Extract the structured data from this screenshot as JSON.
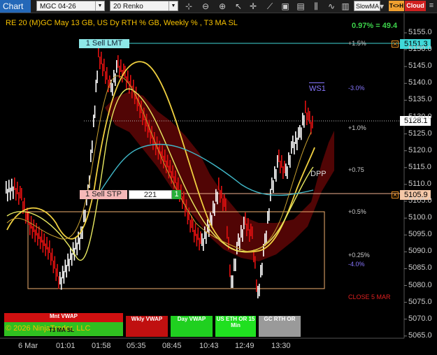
{
  "toolbar": {
    "tab": "Chart",
    "instrument": "MGC 04-26",
    "interval": "20 Renko",
    "strategy": "SlowMA",
    "tchk": "T<>H",
    "cloud": "Cloud"
  },
  "chart": {
    "title": "RE 20  (M)GC May 13 GB, US Dy RTH % GB, Weekly % , T3 MA SL",
    "ratio": "0.97% = 49.4",
    "price_axis": [
      "5155.0",
      "5150.0",
      "5145.0",
      "5140.0",
      "5135.0",
      "5130.0",
      "5125.0",
      "5120.0",
      "5115.0",
      "5110.0",
      "5105.0",
      "5100.0",
      "5095.0",
      "5090.0",
      "5085.0",
      "5080.0",
      "5075.0",
      "5070.0",
      "5065.0"
    ],
    "time_axis": [
      "6 Mar",
      "01:01",
      "01:58",
      "05:35",
      "08:45",
      "10:43",
      "12:49",
      "13:30"
    ],
    "current_price": "5128.1",
    "level_labels": {
      "p15": "+1.5%",
      "m30": "-3.0%",
      "p10": "+1.0%",
      "p075": "+0.75",
      "p05": "+0.5%",
      "p025": "+0.25%",
      "m40": "-4.0%"
    },
    "ws1": "WS1",
    "dpp": "DPP",
    "close_label": "CLOSE 5 MAR"
  },
  "orders": {
    "limit": {
      "label": "1 Sell LMT",
      "price": "5151.3"
    },
    "stop": {
      "label": "1 Sell STP",
      "qty": "221",
      "qty_tag": "1",
      "price": "5105.9"
    }
  },
  "legend": {
    "mnt": "Mnt VWAP",
    "t3": "T3 MA SL",
    "wkly": "Wkly VWAP",
    "day": "Day VWAP",
    "useth": "US ETH OR 15 Min",
    "gcrth": "GC RTH OR",
    "copyright": "© 2026 NinjaTrader, LLC"
  },
  "colors": {
    "accent_blue": "#2468b8",
    "limit_line": "#40d8d8",
    "stop_line": "#f0b090",
    "up_bar": "#ffffff",
    "down_bar": "#e01010",
    "ratio_text": "#3cd24a",
    "title_text": "#f5c000"
  }
}
